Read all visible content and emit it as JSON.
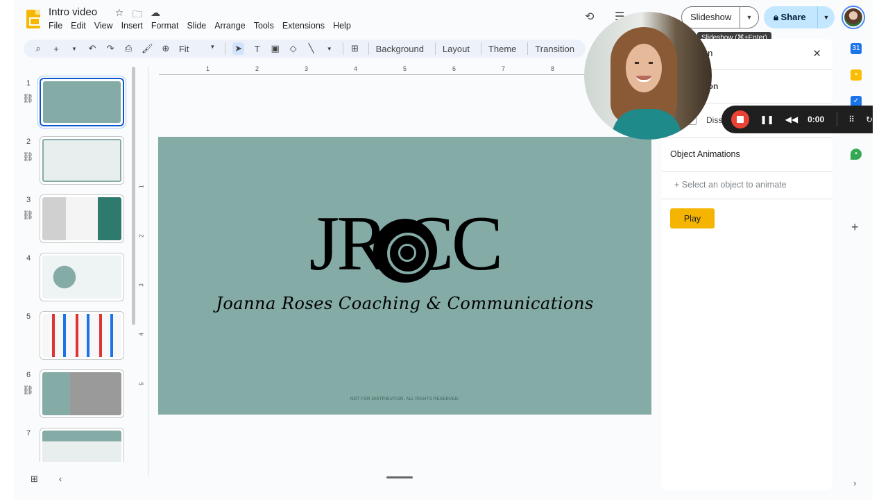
{
  "document": {
    "title": "Intro video"
  },
  "menu": [
    "File",
    "Edit",
    "View",
    "Insert",
    "Format",
    "Slide",
    "Arrange",
    "Tools",
    "Extensions",
    "Help"
  ],
  "header": {
    "slideshow_label": "Slideshow",
    "tooltip": "Slideshow (⌘+Enter)",
    "share_label": "Share"
  },
  "toolbar": {
    "zoom_value": "Fit",
    "background_label": "Background",
    "layout_label": "Layout",
    "theme_label": "Theme",
    "transition_label": "Transition"
  },
  "ruler": {
    "h_ticks": [
      "1",
      "2",
      "3",
      "4",
      "5",
      "6",
      "7",
      "8"
    ],
    "v_ticks": [
      "1",
      "2",
      "3",
      "4",
      "5"
    ]
  },
  "slides": [
    {
      "number": "1",
      "bg": "#84aba6",
      "linked": true,
      "active": true
    },
    {
      "number": "2",
      "bg": "#e8eeed",
      "linked": true,
      "active": false
    },
    {
      "number": "3",
      "bg": "#f1f1f1",
      "linked": true,
      "active": false
    },
    {
      "number": "4",
      "bg": "#eef4f3",
      "linked": false,
      "active": false
    },
    {
      "number": "5",
      "bg": "#f7f7f7",
      "linked": false,
      "active": false
    },
    {
      "number": "6",
      "bg": "#84aba6",
      "linked": true,
      "active": false
    },
    {
      "number": "7",
      "bg": "#e8eeed",
      "linked": false,
      "active": false
    }
  ],
  "slide_content": {
    "logo": "JR  CC",
    "tagline": "Joanna Roses Coaching & Communications",
    "footnote": "NOT FOR DISTRIBUTION. ALL RIGHTS RESERVED."
  },
  "panel": {
    "title_partial": "ion",
    "subheading_partial": "ition",
    "dissolve_partial": "Diss",
    "object_animations": "Object Animations",
    "select_placeholder": "Select an object to animate",
    "play_label": "Play"
  },
  "recorder": {
    "time": "0:00"
  },
  "colors": {
    "slide_bg": "#84aba6",
    "accent_blue": "#0b57d0",
    "share_bg": "#c2e7ff",
    "play_bg": "#f4b400",
    "record_red": "#ea4335"
  }
}
